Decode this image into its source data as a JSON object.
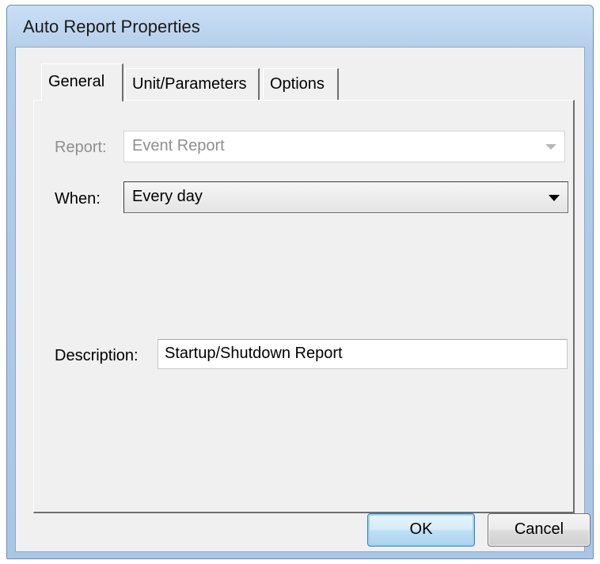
{
  "window": {
    "title": "Auto Report Properties"
  },
  "tabs": [
    {
      "label": "General",
      "selected": true
    },
    {
      "label": "Unit/Parameters",
      "selected": false
    },
    {
      "label": "Options",
      "selected": false
    }
  ],
  "general": {
    "report": {
      "label": "Report:",
      "value": "Event Report",
      "enabled": false
    },
    "when": {
      "label": "When:",
      "value": "Every day",
      "enabled": true
    },
    "description": {
      "label": "Description:",
      "value": "Startup/Shutdown Report"
    }
  },
  "buttons": {
    "ok_label": "OK",
    "cancel_label": "Cancel"
  },
  "icons": {
    "dropdown": "chevron-down-icon"
  },
  "colors": {
    "disabled_text": "#8f8f8f",
    "default_button_border": "#3c7fb1"
  }
}
